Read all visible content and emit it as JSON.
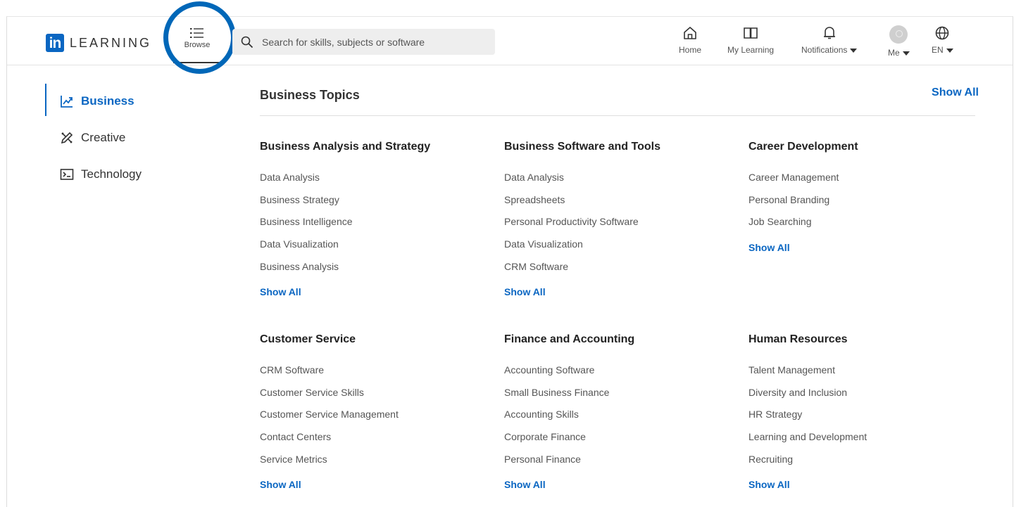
{
  "header": {
    "logo_in": "in",
    "logo_text": "LEARNING",
    "browse_label": "Browse",
    "search_placeholder": "Search for skills, subjects or software",
    "nav": {
      "home": "Home",
      "my_learning": "My Learning",
      "notifications": "Notifications",
      "me": "Me",
      "language": "EN"
    }
  },
  "sidebar": {
    "items": [
      {
        "label": "Business",
        "icon": "chart-line-icon",
        "active": true
      },
      {
        "label": "Creative",
        "icon": "pen-ruler-icon",
        "active": false
      },
      {
        "label": "Technology",
        "icon": "terminal-icon",
        "active": false
      }
    ]
  },
  "main": {
    "title": "Business Topics",
    "show_all": "Show All",
    "categories": [
      {
        "title": "Business Analysis and Strategy",
        "links": [
          "Data Analysis",
          "Business Strategy",
          "Business Intelligence",
          "Data Visualization",
          "Business Analysis"
        ],
        "show_all": "Show All"
      },
      {
        "title": "Business Software and Tools",
        "links": [
          "Data Analysis",
          "Spreadsheets",
          "Personal Productivity Software",
          "Data Visualization",
          "CRM Software"
        ],
        "show_all": "Show All"
      },
      {
        "title": "Career Development",
        "links": [
          "Career Management",
          "Personal Branding",
          "Job Searching"
        ],
        "show_all": "Show All"
      },
      {
        "title": "Customer Service",
        "links": [
          "CRM Software",
          "Customer Service Skills",
          "Customer Service Management",
          "Contact Centers",
          "Service Metrics"
        ],
        "show_all": "Show All"
      },
      {
        "title": "Finance and Accounting",
        "links": [
          "Accounting Software",
          "Small Business Finance",
          "Accounting Skills",
          "Corporate Finance",
          "Personal Finance"
        ],
        "show_all": "Show All"
      },
      {
        "title": "Human Resources",
        "links": [
          "Talent Management",
          "Diversity and Inclusion",
          "HR Strategy",
          "Learning and Development",
          "Recruiting"
        ],
        "show_all": "Show All"
      }
    ]
  },
  "colors": {
    "accent": "#0a66c2",
    "highlight_circle": "#0067b8"
  }
}
